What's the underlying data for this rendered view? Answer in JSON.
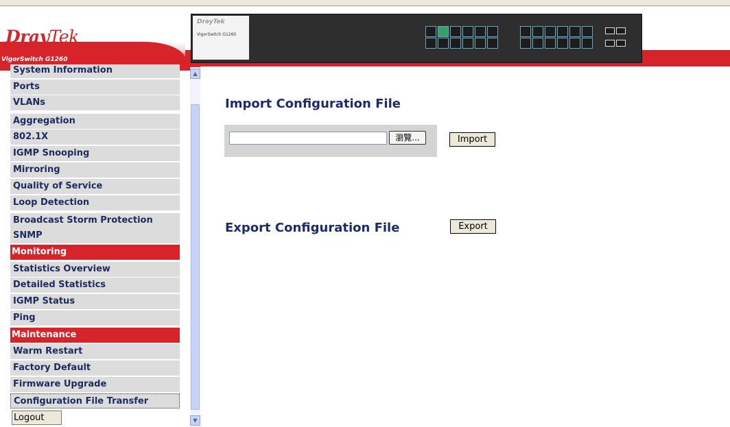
{
  "header": {
    "logo_main": "Dray",
    "logo_accent": "Tek",
    "model": "VigorSwitch G1260",
    "device_brand": "DrayTek",
    "device_model": "VigorSwitch G1260"
  },
  "sidebar": {
    "items": [
      {
        "label": "System Information",
        "type": "item"
      },
      {
        "label": "Ports",
        "type": "item"
      },
      {
        "label": "VLANs",
        "type": "item"
      },
      {
        "label": "Aggregation",
        "type": "item"
      },
      {
        "label": "802.1X",
        "type": "item"
      },
      {
        "label": "IGMP Snooping",
        "type": "item"
      },
      {
        "label": "Mirroring",
        "type": "item"
      },
      {
        "label": "Quality of Service",
        "type": "item"
      },
      {
        "label": "Loop Detection",
        "type": "item"
      },
      {
        "label": "Broadcast Storm Protection",
        "type": "item"
      },
      {
        "label": "SNMP",
        "type": "item"
      },
      {
        "label": "Monitoring",
        "type": "section"
      },
      {
        "label": "Statistics Overview",
        "type": "item"
      },
      {
        "label": "Detailed Statistics",
        "type": "item"
      },
      {
        "label": "IGMP Status",
        "type": "item"
      },
      {
        "label": "Ping",
        "type": "item"
      },
      {
        "label": "Maintenance",
        "type": "section"
      },
      {
        "label": "Warm Restart",
        "type": "item"
      },
      {
        "label": "Factory Default",
        "type": "item"
      },
      {
        "label": "Firmware Upgrade",
        "type": "item"
      },
      {
        "label": "Configuration File Transfer",
        "type": "item",
        "selected": true
      }
    ],
    "logout_label": "Logout"
  },
  "main": {
    "import_heading": "Import Configuration File",
    "browse_label": "瀏覽...",
    "file_value": "",
    "import_button": "Import",
    "export_heading": "Export Configuration File",
    "export_button": "Export"
  },
  "colors": {
    "brand_red": "#d6242a",
    "heading_blue": "#1b2b6e",
    "menu_bg": "#dcdcdc"
  }
}
